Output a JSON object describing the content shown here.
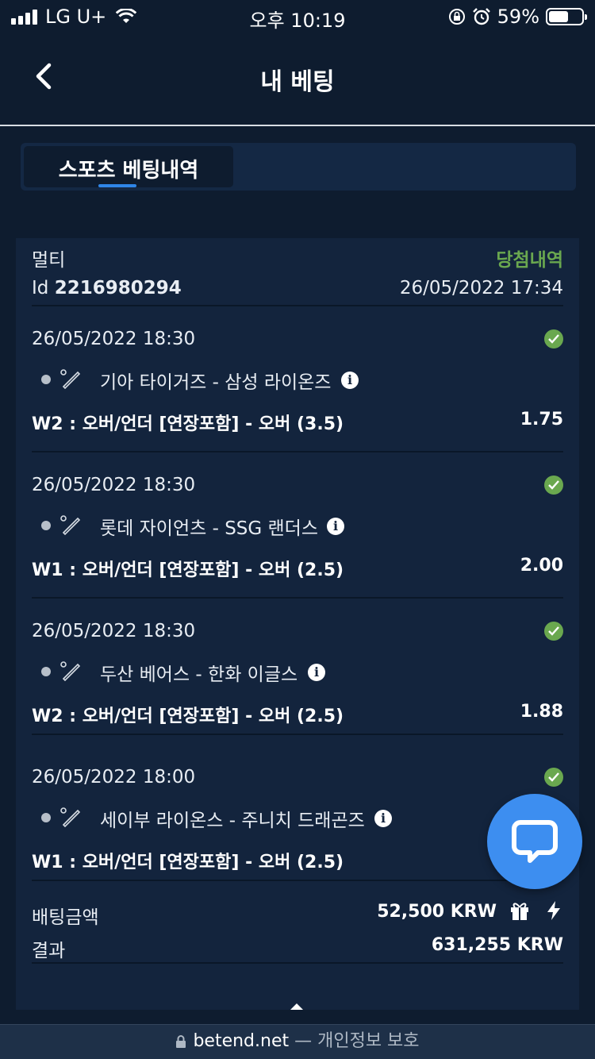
{
  "status_bar": {
    "carrier": "LG U+",
    "time": "오후 10:19",
    "battery_pct": "59%",
    "battery_level": 0.59
  },
  "header": {
    "title": "내 베팅",
    "back_icon": "chevron-left-icon"
  },
  "tabs": [
    {
      "label": "스포츠 베팅내역",
      "active": true
    }
  ],
  "bet": {
    "type": "멀티",
    "status": "당첨내역",
    "id_label": "Id",
    "id_value": "2216980294",
    "placed_at": "26/05/2022 17:34",
    "selections": [
      {
        "datetime": "26/05/2022 18:30",
        "match": "기아 타이거즈 - 삼성 라이온즈",
        "market": "W2 : 오버/언더 [연장포함] - 오버 (3.5)",
        "odds": "1.75"
      },
      {
        "datetime": "26/05/2022 18:30",
        "match": "롯데 자이언츠 - SSG 랜더스",
        "market": "W1 : 오버/언더 [연장포함] - 오버 (2.5)",
        "odds": "2.00"
      },
      {
        "datetime": "26/05/2022 18:30",
        "match": "두산 베어스 - 한화 이글스",
        "market": "W2 : 오버/언더 [연장포함] - 오버 (2.5)",
        "odds": "1.88"
      },
      {
        "datetime": "26/05/2022 18:00",
        "match": "세이부 라이온스 - 주니치 드래곤즈",
        "market": "W1 : 오버/언더 [연장포함] - 오버 (2.5)",
        "odds": ""
      }
    ],
    "stake_label": "배팅금액",
    "stake_value": "52,500 KRW",
    "result_label": "결과",
    "result_value": "631,255 KRW"
  },
  "url_bar": {
    "domain": "betend.net",
    "suffix": "— 개인정보 보호"
  },
  "colors": {
    "background": "#0e1c2f",
    "card": "#13243d",
    "accent": "#2f86e8",
    "win": "#6aa84f",
    "chat": "#3d8ef0"
  }
}
